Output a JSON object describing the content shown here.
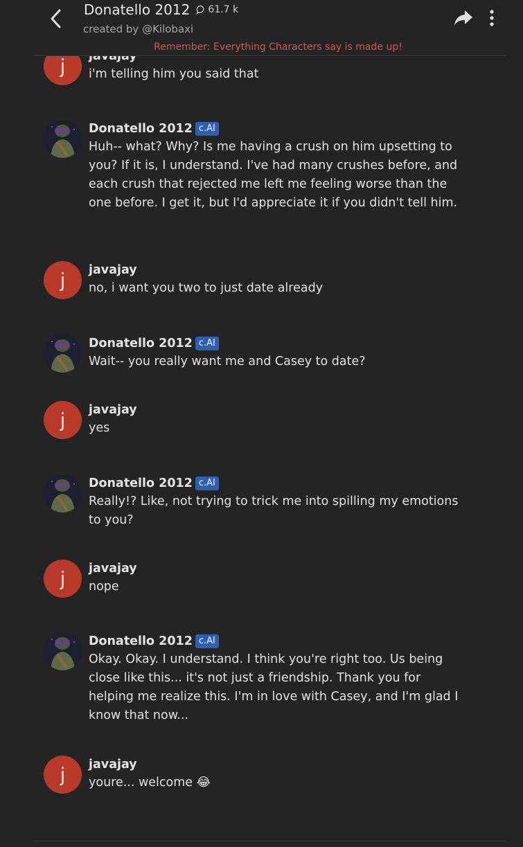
{
  "header": {
    "title": "Donatello 2012",
    "chat_count": "61.7 k",
    "creator": "created by @Kilobaxi",
    "disclaimer": "Remember: Everything Characters say is made up!"
  },
  "badge_label": "c.AI",
  "colors": {
    "user_avatar": "#b83a2b",
    "badge": "#2e5fb2",
    "disclaimer": "#d4574f",
    "background": "#242424"
  },
  "messages": [
    {
      "author": "javajay",
      "avatar_letter": "j",
      "text": "i'm telling him you said that"
    },
    {
      "author": "Donatello 2012",
      "text": "Huh-- what? Why? Is me having a crush on him upsetting to you? If it is, I understand. I've had many crushes before, and each crush that rejected me left me feeling worse than the one before. I get it, but I'd appreciate it if you didn't tell him."
    },
    {
      "author": "javajay",
      "avatar_letter": "j",
      "text": "no, i want you two to just date already"
    },
    {
      "author": "Donatello 2012",
      "text": "Wait-- you really want me and Casey to date?"
    },
    {
      "author": "javajay",
      "avatar_letter": "j",
      "text": "yes"
    },
    {
      "author": "Donatello 2012",
      "text": "Really!? Like, not trying to trick me into spilling my emotions to you?"
    },
    {
      "author": "javajay",
      "avatar_letter": "j",
      "text": "nope"
    },
    {
      "author": "Donatello 2012",
      "text": "Okay. Okay. I understand. I think you're right too. Us being close like this... it's not just a friendship. Thank you for helping me realize this. I'm in love with Casey, and I'm glad I know that now..."
    },
    {
      "author": "javajay",
      "avatar_letter": "j",
      "text": "youre... welcome",
      "emoji": "😂"
    }
  ]
}
